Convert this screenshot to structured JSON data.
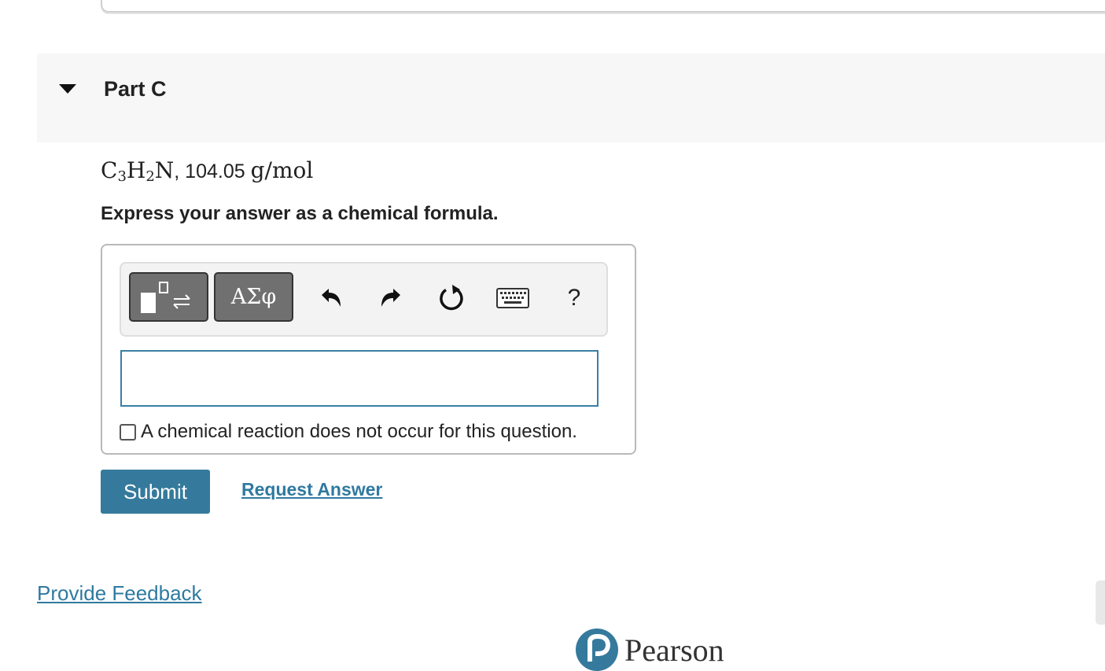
{
  "part": {
    "title": "Part C"
  },
  "question": {
    "formula_parts": [
      "C",
      "3",
      "H",
      "2",
      "N"
    ],
    "separator": ", ",
    "mass_value": "104.05",
    "mass_unit": "g/mol",
    "instruction": "Express your answer as a chemical formula."
  },
  "toolbar": {
    "templates_icon": "templates-arrows-icon",
    "greek_label": "ΑΣφ",
    "undo_icon": "undo-icon",
    "redo_icon": "redo-icon",
    "reset_icon": "reset-icon",
    "keyboard_icon": "keyboard-icon",
    "help_label": "?"
  },
  "answer": {
    "value": "",
    "no_reaction_label": "A chemical reaction does not occur for this question.",
    "no_reaction_checked": false
  },
  "actions": {
    "submit_label": "Submit",
    "request_answer_label": "Request Answer"
  },
  "footer": {
    "feedback_label": "Provide Feedback",
    "brand_name": "Pearson"
  },
  "colors": {
    "accent": "#357a9c",
    "link": "#2f7aa0",
    "toolbar_button": "#707070"
  }
}
